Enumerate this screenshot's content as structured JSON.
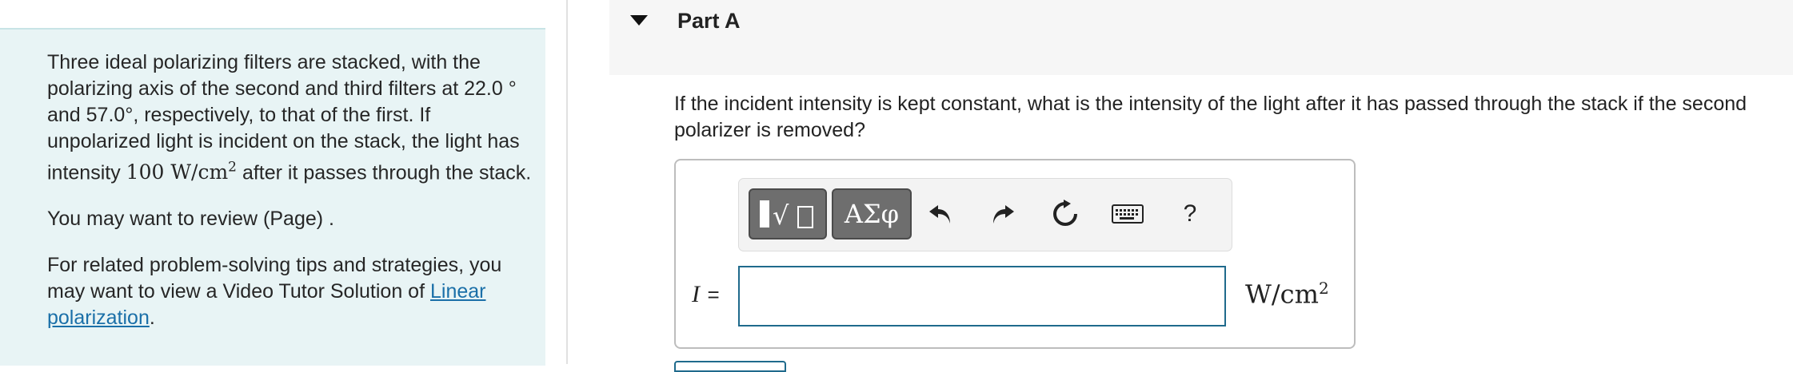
{
  "problem": {
    "text_start": "Three ideal polarizing filters are stacked, with the polarizing axis of the second and third filters at 22.0",
    "text_mid1": "and 57.0",
    "text_mid2": ", respectively, to that of the first. If unpolarized light is incident on the stack, the light has intensity",
    "intensity_value": "100",
    "intensity_unit": "W/cm",
    "text_end": "after it passes through the stack.",
    "review": "You may want to review (Page) .",
    "tips": "For related problem-solving tips and strategies, you may want to view a Video Tutor Solution of",
    "link": "Linear polarization",
    "link_after": "."
  },
  "part": {
    "title": "Part A",
    "expanded_icon": "caret-down-icon"
  },
  "question": {
    "line1": "If the incident intensity is kept constant, what is the intensity of the light after it has passed through the stack if the second",
    "line2": "polarizer is removed?"
  },
  "answer": {
    "variable": "I",
    "equals": "=",
    "value": "",
    "unit": "W/cm",
    "unit_exp": "2"
  },
  "toolbar": {
    "templates_icon": "templates-icon",
    "greek_label": "ΑΣφ",
    "undo_icon": "undo-icon",
    "redo_icon": "redo-icon",
    "reset_icon": "reset-icon",
    "keyboard_icon": "keyboard-icon",
    "help_label": "?"
  },
  "colors": {
    "left_panel_bg": "#e8f4f5",
    "link": "#1a6fa8",
    "input_border": "#1f6a8c"
  }
}
